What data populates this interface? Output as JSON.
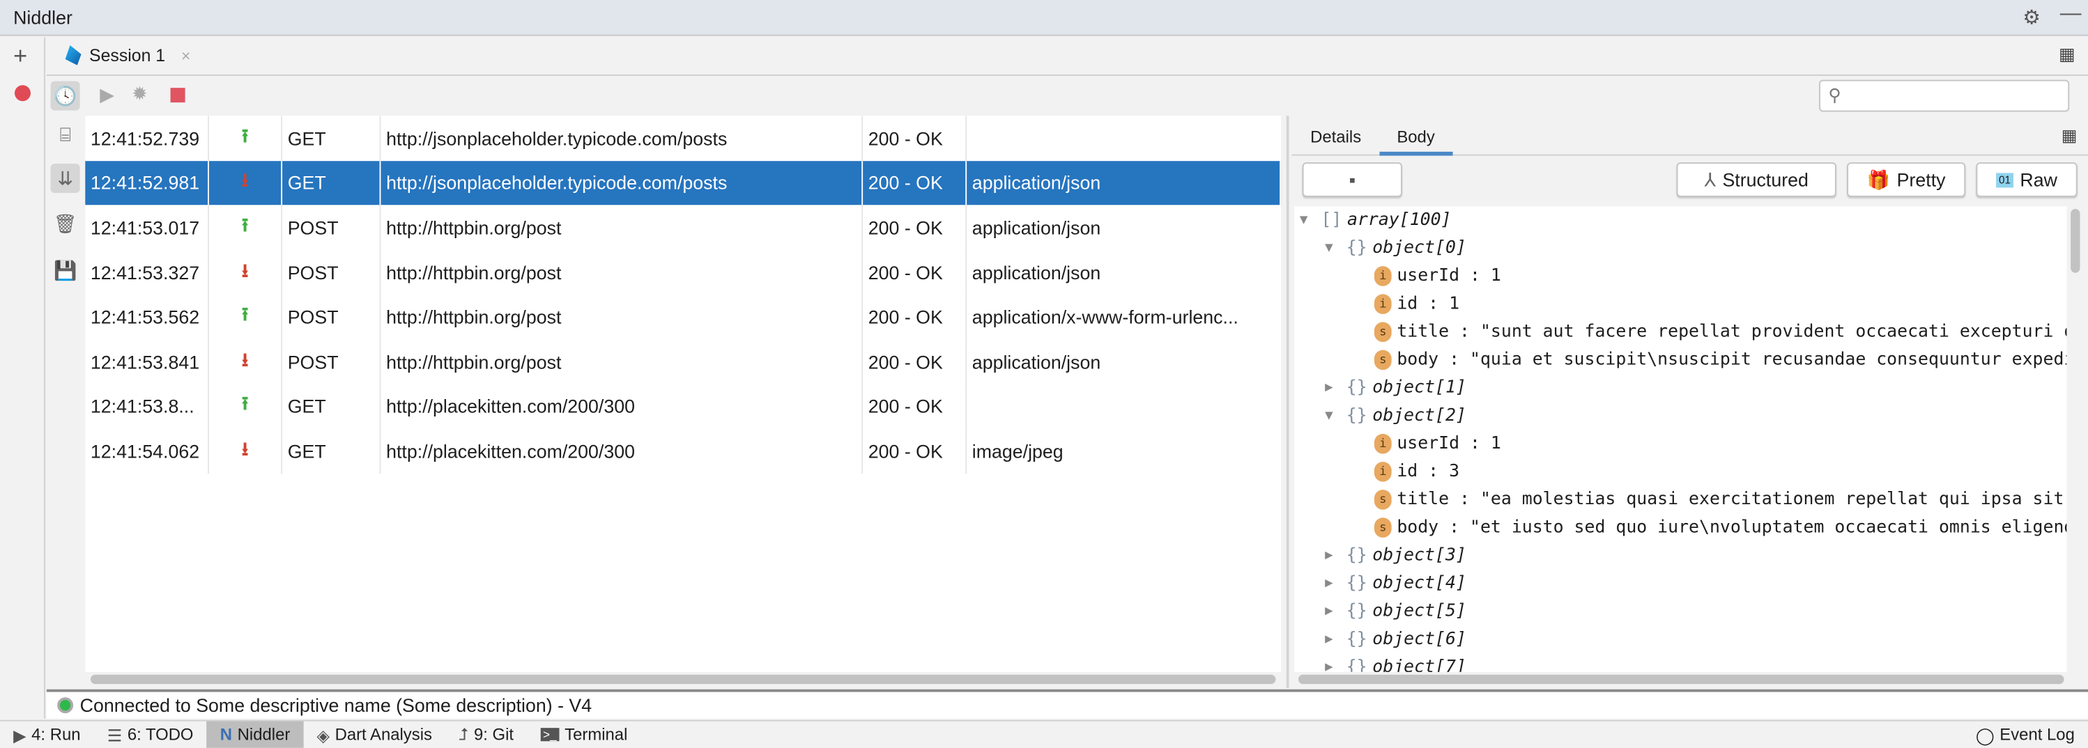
{
  "window": {
    "title": "Niddler"
  },
  "tabs": [
    {
      "label": "Session 1"
    }
  ],
  "requests": [
    {
      "time": "12:41:52.739",
      "direction": "up",
      "method": "GET",
      "url": "http://jsonplaceholder.typicode.com/posts",
      "status": "200 - OK",
      "type": ""
    },
    {
      "time": "12:41:52.981",
      "direction": "down",
      "method": "GET",
      "url": "http://jsonplaceholder.typicode.com/posts",
      "status": "200 - OK",
      "type": "application/json",
      "selected": true
    },
    {
      "time": "12:41:53.017",
      "direction": "up",
      "method": "POST",
      "url": "http://httpbin.org/post",
      "status": "200 - OK",
      "type": "application/json"
    },
    {
      "time": "12:41:53.327",
      "direction": "down",
      "method": "POST",
      "url": "http://httpbin.org/post",
      "status": "200 - OK",
      "type": "application/json"
    },
    {
      "time": "12:41:53.562",
      "direction": "up",
      "method": "POST",
      "url": "http://httpbin.org/post",
      "status": "200 - OK",
      "type": "application/x-www-form-urlenc..."
    },
    {
      "time": "12:41:53.841",
      "direction": "down",
      "method": "POST",
      "url": "http://httpbin.org/post",
      "status": "200 - OK",
      "type": "application/json"
    },
    {
      "time": "12:41:53.8...",
      "direction": "up",
      "method": "GET",
      "url": "http://placekitten.com/200/300",
      "status": "200 - OK",
      "type": ""
    },
    {
      "time": "12:41:54.062",
      "direction": "down",
      "method": "GET",
      "url": "http://placekitten.com/200/300",
      "status": "200 - OK",
      "type": "image/jpeg"
    }
  ],
  "detail": {
    "tabs": [
      "Details",
      "Body"
    ],
    "active_tab": "Body",
    "buttons": {
      "structured": "Structured",
      "pretty": "Pretty",
      "raw": "Raw",
      "raw_icon": "01"
    },
    "tree": [
      {
        "level": 0,
        "open": true,
        "bracket": "[]",
        "label": "array[100]"
      },
      {
        "level": 1,
        "open": true,
        "bracket": "{}",
        "label": "object[0]"
      },
      {
        "level": 2,
        "badge": "i",
        "label": "userId : 1"
      },
      {
        "level": 2,
        "badge": "i",
        "label": "id : 1"
      },
      {
        "level": 2,
        "badge": "s",
        "label": "title : \"sunt aut facere repellat provident occaecati excepturi opt"
      },
      {
        "level": 2,
        "badge": "s",
        "label": "body : \"quia et suscipit\\nsuscipit recusandae consequuntur expedita"
      },
      {
        "level": 1,
        "open": false,
        "bracket": "{}",
        "label": "object[1]"
      },
      {
        "level": 1,
        "open": true,
        "bracket": "{}",
        "label": "object[2]"
      },
      {
        "level": 2,
        "badge": "i",
        "label": "userId : 1"
      },
      {
        "level": 2,
        "badge": "i",
        "label": "id : 3"
      },
      {
        "level": 2,
        "badge": "s",
        "label": "title : \"ea molestias quasi exercitationem repellat qui ipsa sit aut"
      },
      {
        "level": 2,
        "badge": "s",
        "label": "body : \"et iusto sed quo iure\\nvoluptatem occaecati omnis eligendi"
      },
      {
        "level": 1,
        "open": false,
        "bracket": "{}",
        "label": "object[3]"
      },
      {
        "level": 1,
        "open": false,
        "bracket": "{}",
        "label": "object[4]"
      },
      {
        "level": 1,
        "open": false,
        "bracket": "{}",
        "label": "object[5]"
      },
      {
        "level": 1,
        "open": false,
        "bracket": "{}",
        "label": "object[6]"
      },
      {
        "level": 1,
        "open": false,
        "bracket": "{}",
        "label": "object[7]"
      }
    ]
  },
  "status": {
    "text": "Connected to Some descriptive name (Some description) - V4",
    "color": "#2fb84a"
  },
  "bottom_bar": [
    {
      "label": "4: Run"
    },
    {
      "label": "6: TODO"
    },
    {
      "label": "Niddler",
      "active": true
    },
    {
      "label": "Dart Analysis"
    },
    {
      "label": "9: Git"
    },
    {
      "label": "Terminal"
    }
  ],
  "event_log": "Event Log",
  "colors": {
    "selection": "#2675bf",
    "upload": "#3fae3f",
    "download": "#d0432f",
    "stop": "#e05561"
  }
}
